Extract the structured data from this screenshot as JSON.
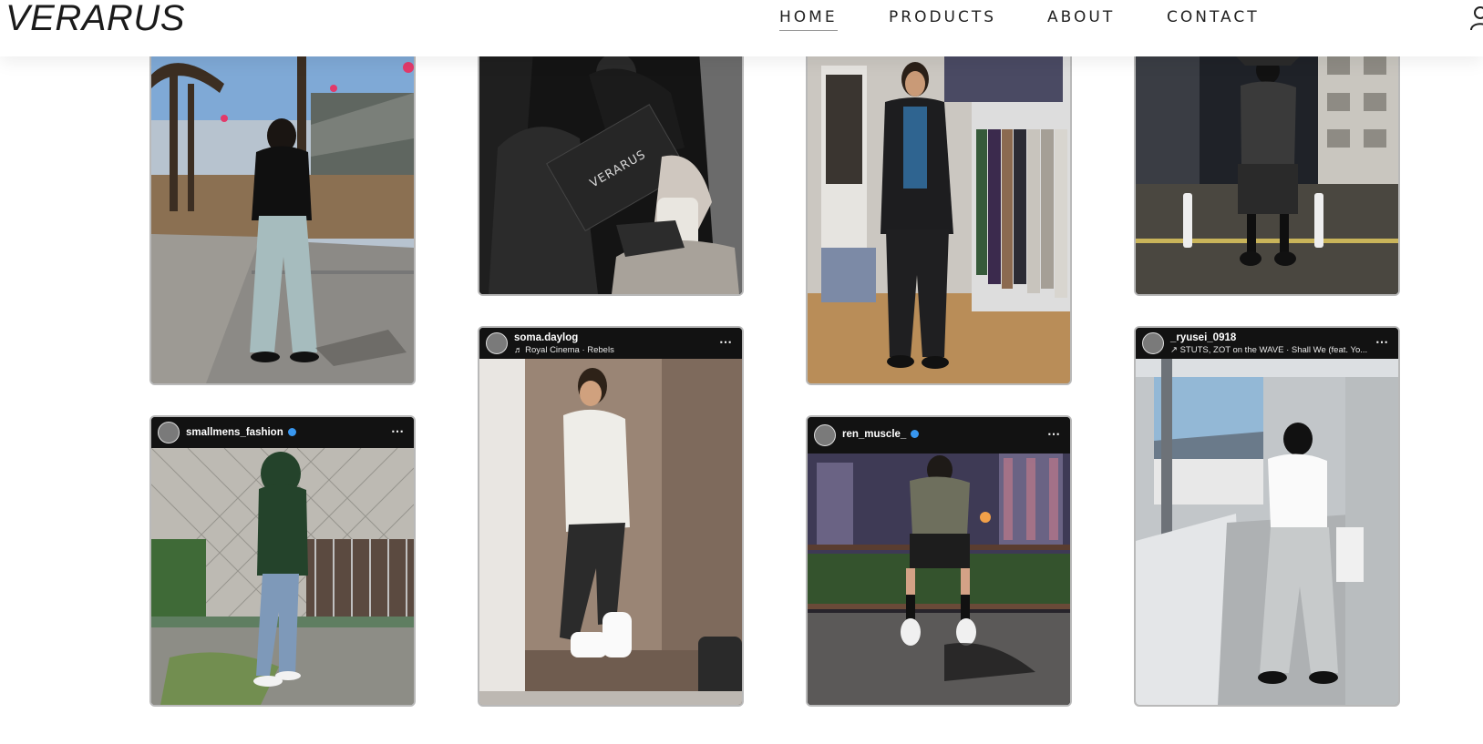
{
  "brand": {
    "logo": "VERARUS"
  },
  "nav": {
    "items": [
      {
        "label": "HOME",
        "active": true
      },
      {
        "label": "PRODUCTS",
        "active": false
      },
      {
        "label": "ABOUT",
        "active": false
      },
      {
        "label": "CONTACT",
        "active": false
      }
    ]
  },
  "posts": {
    "smallmens": {
      "username": "smallmens_fashion",
      "verified": true
    },
    "soma": {
      "username": "soma.daylog",
      "music": "♬ Royal Cinema · Rebels"
    },
    "ren": {
      "username": "ren_muscle_",
      "verified": true
    },
    "ryusei": {
      "username": "_ryusei_0918",
      "music": "↗ STUTS, ZOT on the WAVE · Shall We (feat. Yo..."
    },
    "more_icon": "⋯"
  },
  "colors": {
    "text": "#1a1a1a",
    "verified": "#3897f0",
    "card_border": "#b9b9b9"
  },
  "icons": [
    "user-icon",
    "verified-badge-icon",
    "more-options-icon",
    "music-note-icon"
  ]
}
